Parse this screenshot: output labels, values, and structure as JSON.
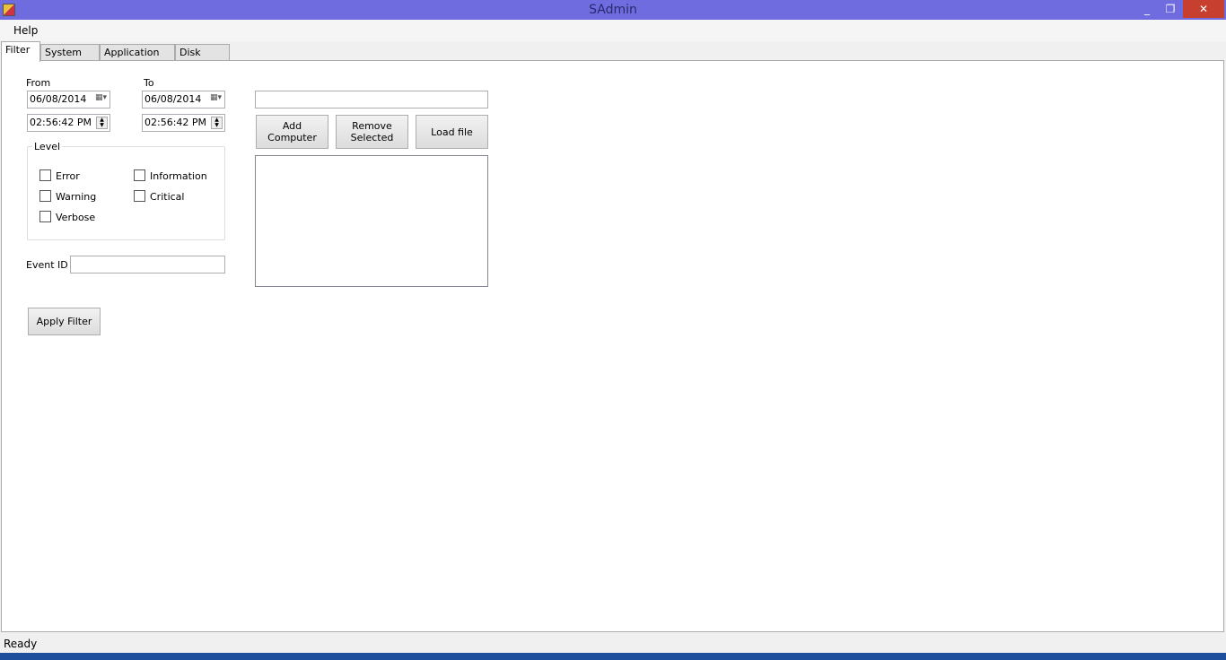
{
  "window": {
    "title": "SAdmin",
    "minimize": "_",
    "restore": "❐",
    "close": "✕"
  },
  "menu": {
    "help": "Help"
  },
  "tabs": [
    {
      "label": "Filter",
      "active": true
    },
    {
      "label": "System Log"
    },
    {
      "label": "Application Log"
    },
    {
      "label": "Disk Space"
    }
  ],
  "filter": {
    "from_label": "From",
    "to_label": "To",
    "from_date": "06/08/2014",
    "from_time": "02:56:42 PM",
    "to_date": "06/08/2014",
    "to_time": "02:56:42 PM",
    "level_label": "Level",
    "levels": [
      {
        "label": "Error",
        "checked": false
      },
      {
        "label": "Information",
        "checked": false
      },
      {
        "label": "Warning",
        "checked": false
      },
      {
        "label": "Critical",
        "checked": false
      },
      {
        "label": "Verbose",
        "checked": false
      }
    ],
    "event_id_label": "Event ID",
    "event_id_value": "",
    "apply_label": "Apply Filter"
  },
  "computers": {
    "input_value": "",
    "add_label": "Add Computer",
    "remove_label": "Remove Selected",
    "load_label": "Load file",
    "items": []
  },
  "status": "Ready"
}
